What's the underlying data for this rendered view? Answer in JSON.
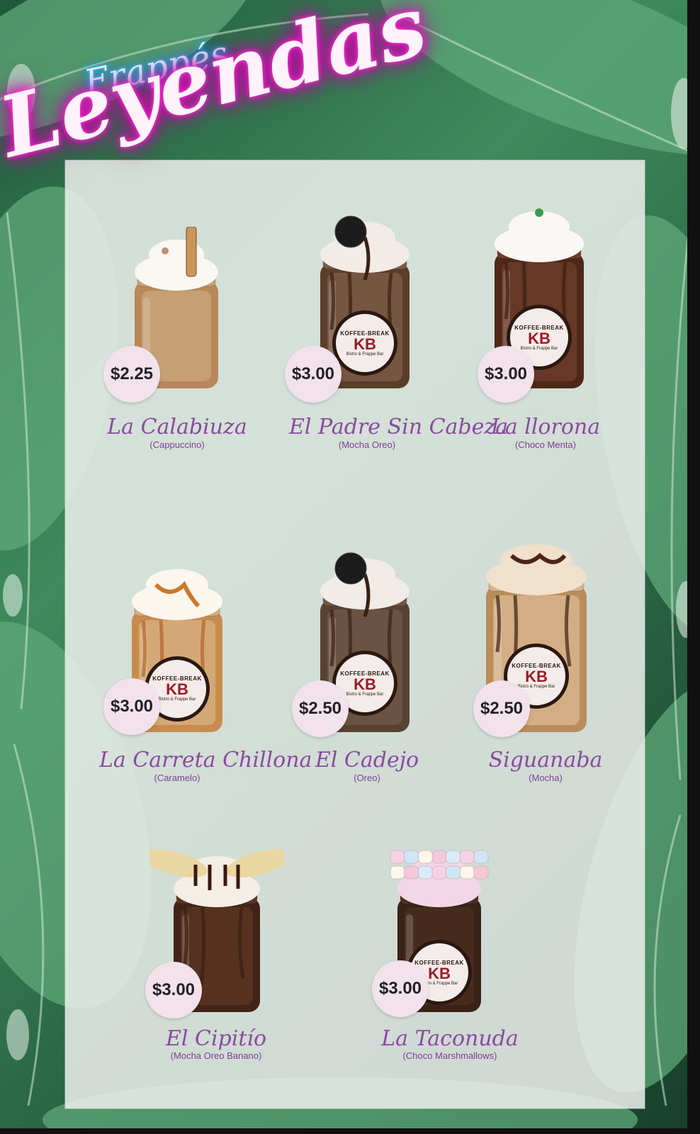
{
  "header": {
    "subtitle": "Frappés",
    "title": "Leyendas"
  },
  "badge_text": {
    "brand_top": "KOFFEE-BREAK",
    "initials": "KB",
    "brand_bottom": "Bistro & Frappe Bar"
  },
  "colors": {
    "panel": "#eef0ee",
    "price_bubble": "#f1e2ec",
    "name_text": "#8a4aa0",
    "title_glow_pink": "#f012c4",
    "subtitle_glow_blue": "#14a8ff"
  },
  "items": [
    {
      "name": "La Calabiuza",
      "flavor": "(Cappuccino)",
      "price": "$2.25",
      "style": "cappuccino",
      "badge": false,
      "topping": "wafer-stick"
    },
    {
      "name": "El Padre Sin Cabeza",
      "flavor": "(Mocha Oreo)",
      "price": "$3.00",
      "style": "mocha-oreo",
      "badge": true,
      "topping": "oreo"
    },
    {
      "name": "La llorona",
      "flavor": "(Choco Menta)",
      "price": "$3.00",
      "style": "choco-menta",
      "badge": true,
      "topping": "mint"
    },
    {
      "name": "La Carreta Chillona",
      "flavor": "(Caramelo)",
      "price": "$3.00",
      "style": "caramelo",
      "badge": true,
      "topping": "caramel"
    },
    {
      "name": "El Cadejo",
      "flavor": "(Oreo)",
      "price": "$2.50",
      "style": "oreo",
      "badge": true,
      "topping": "oreo"
    },
    {
      "name": "Siguanaba",
      "flavor": "(Mocha)",
      "price": "$2.50",
      "style": "mocha",
      "badge": true,
      "topping": "chocolate-drizzle"
    },
    {
      "name": "El Cipitío",
      "flavor": "(Mocha Oreo Banano)",
      "price": "$3.00",
      "style": "banano",
      "badge": false,
      "topping": "banana"
    },
    {
      "name": "La Taconuda",
      "flavor": "(Choco Marshmallows)",
      "price": "$3.00",
      "style": "marshmallow",
      "badge": true,
      "topping": "marshmallows"
    }
  ]
}
